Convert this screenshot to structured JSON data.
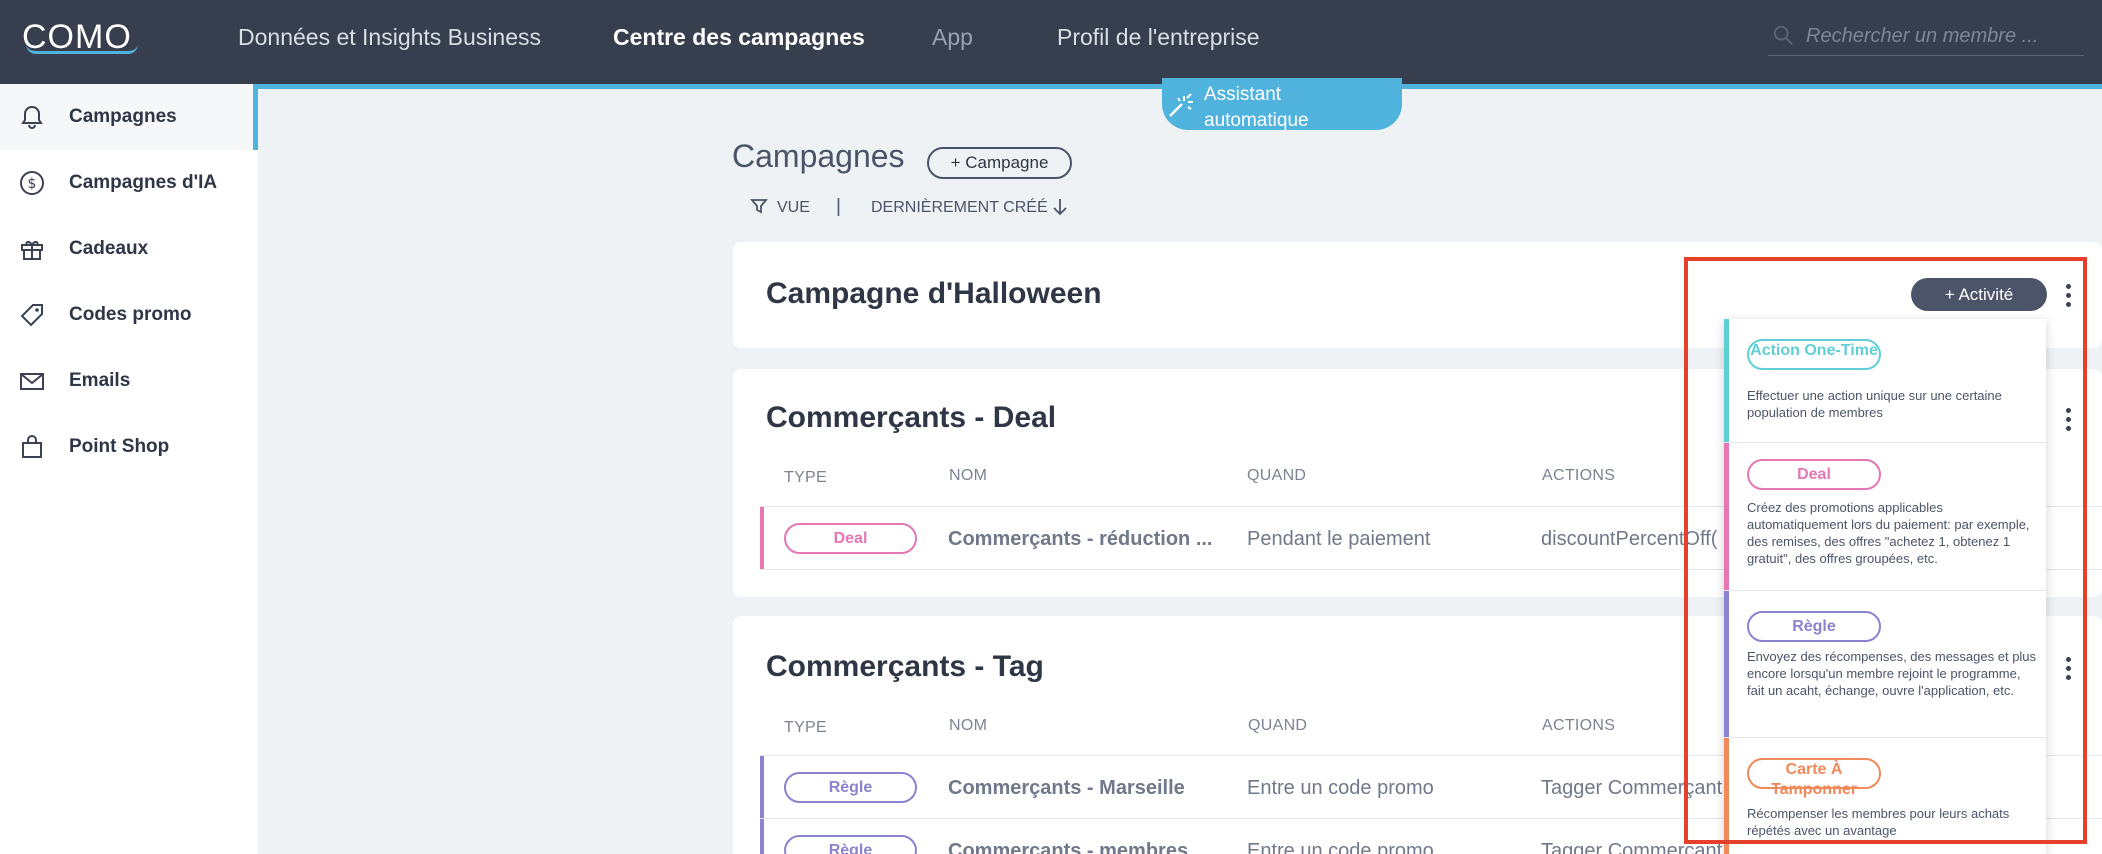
{
  "brand": {
    "logo_text": "COMO"
  },
  "nav": {
    "items": [
      {
        "label": "Données et Insights Business"
      },
      {
        "label": "Centre des campagnes"
      },
      {
        "label": "App"
      },
      {
        "label": "Profil de l'entreprise"
      }
    ],
    "search_placeholder": "Rechercher un membre ..."
  },
  "sidebar": {
    "items": [
      {
        "label": "Campagnes",
        "icon": "bell-icon"
      },
      {
        "label": "Campagnes d'IA",
        "icon": "dollar-circle-icon"
      },
      {
        "label": "Cadeaux",
        "icon": "gift-icon"
      },
      {
        "label": "Codes promo",
        "icon": "tag-icon"
      },
      {
        "label": "Emails",
        "icon": "envelope-icon"
      },
      {
        "label": "Point Shop",
        "icon": "shopping-bag-icon"
      }
    ]
  },
  "assistant": {
    "label_line1": "Assistant",
    "label_line2": "automatique"
  },
  "page": {
    "title": "Campagnes",
    "add_button": "+ Campagne",
    "filter_label": "VUE",
    "separator": "|",
    "sort_label": "DERNIÈREMENT CRÉÉ"
  },
  "table_headers": {
    "type": "TYPE",
    "name": "NOM",
    "when": "QUAND",
    "actions": "ACTIONS"
  },
  "campaigns": [
    {
      "title": "Campagne d'Halloween",
      "activity_button": "+ Activité"
    },
    {
      "title": "Commerçants - Deal",
      "rows": [
        {
          "type": "Deal",
          "name": "Commerçants - réduction ...",
          "when": "Pendant le paiement",
          "action": "discountPercentOff("
        }
      ]
    },
    {
      "title": "Commerçants - Tag",
      "rows": [
        {
          "type": "Règle",
          "name": "Commerçants - Marseille",
          "when": "Entre un code promo",
          "action": "Tagger Commerçant"
        },
        {
          "type": "Règle",
          "name": "Commerçants - membres",
          "when": "Entre un code promo",
          "action": "Tagger Commerçant"
        }
      ]
    }
  ],
  "activity_menu": [
    {
      "label": "Action One-Time",
      "description": "Effectuer une action unique sur une certaine population de membres"
    },
    {
      "label": "Deal",
      "description": "Créez des promotions applicables automatiquement lors du paiement: par exemple, des remises, des offres \"achetez 1, obtenez 1 gratuit\", des offres groupées, etc."
    },
    {
      "label": "Règle",
      "description": "Envoyez des récompenses, des messages et plus encore lorsqu'un membre rejoint le programme, fait un acaht, échange, ouvre l'application, etc."
    },
    {
      "label": "Carte À Tamponner",
      "description": "Récompenser les membres pour leurs achats répétés avec un avantage"
    }
  ],
  "colors": {
    "topbar": "#373f4e",
    "accent": "#4fb3de",
    "one_time": "#5fcfd6",
    "deal": "#e477b4",
    "rule": "#8a83d0",
    "punch": "#f08a5a",
    "highlight": "#e5402b"
  }
}
